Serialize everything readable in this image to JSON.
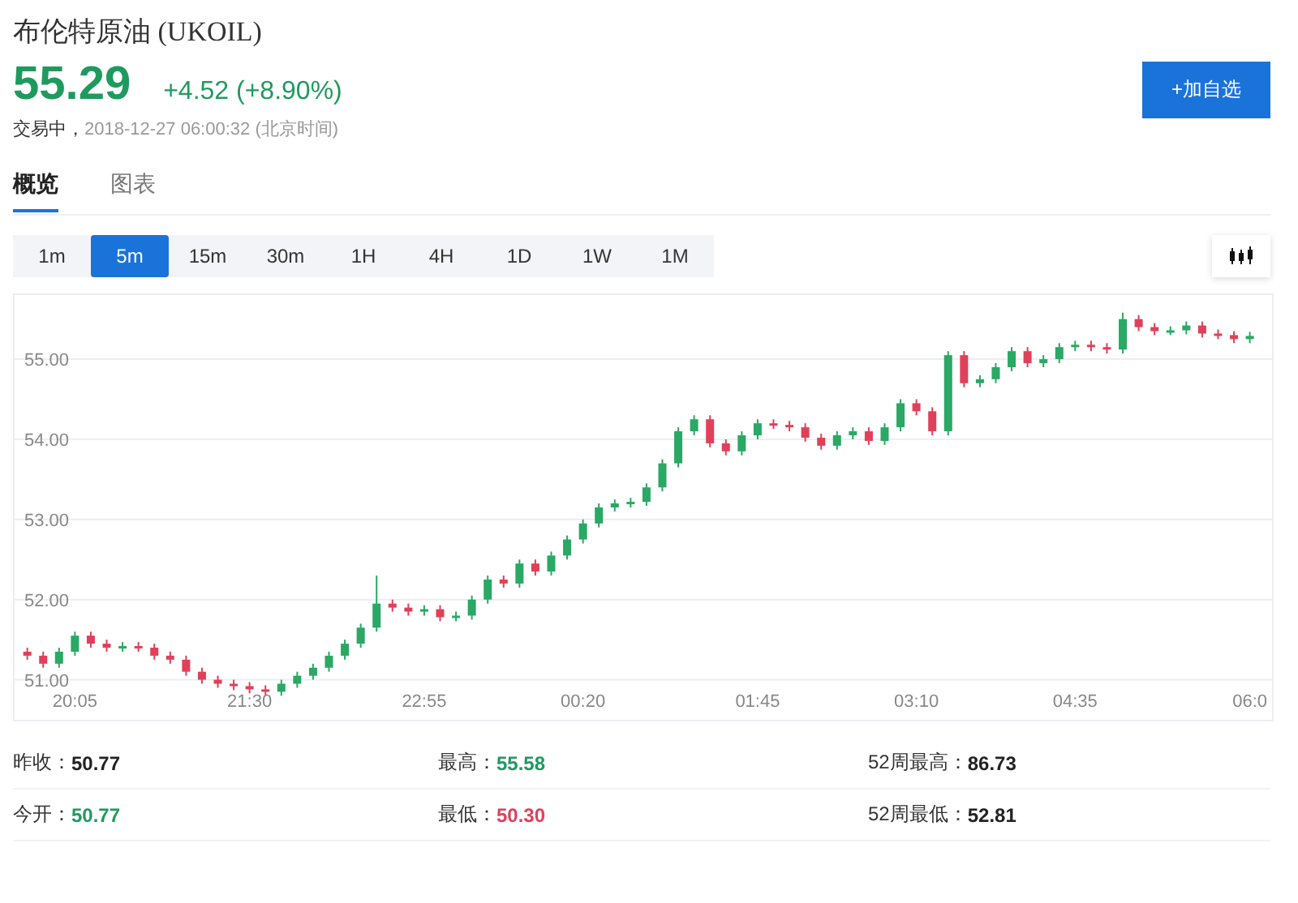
{
  "header": {
    "title": "布伦特原油 (UKOIL)",
    "price": "55.29",
    "change": "+4.52 (+8.90%)",
    "status": "交易中，",
    "time": "2018-12-27 06:00:32 (北京时间)",
    "add_button": "+加自选"
  },
  "tabs": [
    {
      "label": "概览",
      "selected": true
    },
    {
      "label": "图表",
      "selected": false
    }
  ],
  "ranges": [
    {
      "label": "1m",
      "selected": false
    },
    {
      "label": "5m",
      "selected": true
    },
    {
      "label": "15m",
      "selected": false
    },
    {
      "label": "30m",
      "selected": false
    },
    {
      "label": "1H",
      "selected": false
    },
    {
      "label": "4H",
      "selected": false
    },
    {
      "label": "1D",
      "selected": false
    },
    {
      "label": "1W",
      "selected": false
    },
    {
      "label": "1M",
      "selected": false
    }
  ],
  "chart": {
    "chart_data": {
      "type": "candlestick",
      "grid": true,
      "ylim": [
        50.5,
        55.8
      ],
      "yticks": [
        {
          "value": 51,
          "label": "51.00"
        },
        {
          "value": 52,
          "label": "52.00"
        },
        {
          "value": 53,
          "label": "53.00"
        },
        {
          "value": 54,
          "label": "54.00"
        },
        {
          "value": 55,
          "label": "55.00"
        }
      ],
      "categories": [
        null,
        null,
        null,
        "20:05",
        null,
        null,
        null,
        null,
        null,
        null,
        null,
        null,
        null,
        null,
        "21:30",
        null,
        null,
        null,
        null,
        null,
        null,
        null,
        null,
        null,
        null,
        "22:55",
        null,
        null,
        null,
        null,
        null,
        null,
        null,
        null,
        null,
        "00:20",
        null,
        null,
        null,
        null,
        null,
        null,
        null,
        null,
        null,
        null,
        "01:45",
        null,
        null,
        null,
        null,
        null,
        null,
        null,
        null,
        null,
        "03:10",
        null,
        null,
        null,
        null,
        null,
        null,
        null,
        null,
        null,
        "04:35",
        null,
        null,
        null,
        null,
        null,
        null,
        null,
        null,
        null,
        null,
        "06:0"
      ],
      "ohlc": [
        [
          51.35,
          51.4,
          51.25,
          51.3
        ],
        [
          51.3,
          51.35,
          51.15,
          51.2
        ],
        [
          51.2,
          51.4,
          51.15,
          51.35
        ],
        [
          51.35,
          51.6,
          51.3,
          51.55
        ],
        [
          51.55,
          51.6,
          51.4,
          51.45
        ],
        [
          51.45,
          51.5,
          51.35,
          51.4
        ],
        [
          51.4,
          51.47,
          51.35,
          51.42
        ],
        [
          51.42,
          51.47,
          51.35,
          51.4
        ],
        [
          51.4,
          51.45,
          51.25,
          51.3
        ],
        [
          51.3,
          51.35,
          51.2,
          51.25
        ],
        [
          51.25,
          51.3,
          51.05,
          51.1
        ],
        [
          51.1,
          51.15,
          50.95,
          51.0
        ],
        [
          51.0,
          51.05,
          50.9,
          50.95
        ],
        [
          50.95,
          51.0,
          50.87,
          50.92
        ],
        [
          50.92,
          50.97,
          50.83,
          50.88
        ],
        [
          50.88,
          50.93,
          50.8,
          50.85
        ],
        [
          50.85,
          51.0,
          50.8,
          50.95
        ],
        [
          50.95,
          51.1,
          50.9,
          51.05
        ],
        [
          51.05,
          51.2,
          51.0,
          51.15
        ],
        [
          51.15,
          51.35,
          51.1,
          51.3
        ],
        [
          51.3,
          51.5,
          51.25,
          51.45
        ],
        [
          51.45,
          51.7,
          51.4,
          51.65
        ],
        [
          51.65,
          52.3,
          51.6,
          51.95
        ],
        [
          51.95,
          52.0,
          51.85,
          51.9
        ],
        [
          51.9,
          51.95,
          51.8,
          51.85
        ],
        [
          51.85,
          51.93,
          51.8,
          51.88
        ],
        [
          51.88,
          51.93,
          51.73,
          51.78
        ],
        [
          51.78,
          51.85,
          51.73,
          51.8
        ],
        [
          51.8,
          52.05,
          51.75,
          52.0
        ],
        [
          52.0,
          52.3,
          51.95,
          52.25
        ],
        [
          52.25,
          52.3,
          52.15,
          52.2
        ],
        [
          52.2,
          52.5,
          52.15,
          52.45
        ],
        [
          52.45,
          52.5,
          52.3,
          52.35
        ],
        [
          52.35,
          52.6,
          52.3,
          52.55
        ],
        [
          52.55,
          52.8,
          52.5,
          52.75
        ],
        [
          52.75,
          53.0,
          52.7,
          52.95
        ],
        [
          52.95,
          53.2,
          52.9,
          53.15
        ],
        [
          53.15,
          53.25,
          53.1,
          53.2
        ],
        [
          53.2,
          53.27,
          53.15,
          53.22
        ],
        [
          53.22,
          53.45,
          53.17,
          53.4
        ],
        [
          53.4,
          53.75,
          53.35,
          53.7
        ],
        [
          53.7,
          54.15,
          53.65,
          54.1
        ],
        [
          54.1,
          54.3,
          54.05,
          54.25
        ],
        [
          54.25,
          54.3,
          53.9,
          53.95
        ],
        [
          53.95,
          54.0,
          53.8,
          53.85
        ],
        [
          53.85,
          54.1,
          53.8,
          54.05
        ],
        [
          54.05,
          54.25,
          54.0,
          54.2
        ],
        [
          54.2,
          54.25,
          54.13,
          54.18
        ],
        [
          54.18,
          54.23,
          54.1,
          54.15
        ],
        [
          54.15,
          54.2,
          53.97,
          54.02
        ],
        [
          54.02,
          54.07,
          53.87,
          53.92
        ],
        [
          53.92,
          54.1,
          53.87,
          54.05
        ],
        [
          54.05,
          54.15,
          54.0,
          54.1
        ],
        [
          54.1,
          54.15,
          53.93,
          53.98
        ],
        [
          53.98,
          54.2,
          53.93,
          54.15
        ],
        [
          54.15,
          54.5,
          54.1,
          54.45
        ],
        [
          54.45,
          54.5,
          54.3,
          54.35
        ],
        [
          54.35,
          54.4,
          54.05,
          54.1
        ],
        [
          54.1,
          55.1,
          54.05,
          55.05
        ],
        [
          55.05,
          55.1,
          54.65,
          54.7
        ],
        [
          54.7,
          54.8,
          54.65,
          54.75
        ],
        [
          54.75,
          54.95,
          54.7,
          54.9
        ],
        [
          54.9,
          55.15,
          54.85,
          55.1
        ],
        [
          55.1,
          55.15,
          54.9,
          54.95
        ],
        [
          54.95,
          55.05,
          54.9,
          55.0
        ],
        [
          55.0,
          55.2,
          54.95,
          55.15
        ],
        [
          55.15,
          55.23,
          55.1,
          55.18
        ],
        [
          55.18,
          55.23,
          55.1,
          55.15
        ],
        [
          55.15,
          55.2,
          55.07,
          55.12
        ],
        [
          55.12,
          55.58,
          55.07,
          55.5
        ],
        [
          55.5,
          55.55,
          55.35,
          55.4
        ],
        [
          55.4,
          55.45,
          55.3,
          55.35
        ],
        [
          55.35,
          55.41,
          55.3,
          55.36
        ],
        [
          55.36,
          55.47,
          55.31,
          55.42
        ],
        [
          55.42,
          55.47,
          55.27,
          55.32
        ],
        [
          55.32,
          55.37,
          55.25,
          55.3
        ],
        [
          55.3,
          55.35,
          55.2,
          55.25
        ],
        [
          55.25,
          55.34,
          55.2,
          55.29
        ]
      ]
    }
  },
  "stats": [
    {
      "label": "昨收：",
      "value": "50.77",
      "color": "#222222"
    },
    {
      "label": "最高：",
      "value": "55.58",
      "color": "#1f9a5f"
    },
    {
      "label": "52周最高：",
      "value": "86.73",
      "color": "#222222"
    },
    {
      "label": "今开：",
      "value": "50.77",
      "color": "#1f9a5f"
    },
    {
      "label": "最低：",
      "value": "50.30",
      "color": "#e0405a"
    },
    {
      "label": "52周最低：",
      "value": "52.81",
      "color": "#222222"
    }
  ]
}
